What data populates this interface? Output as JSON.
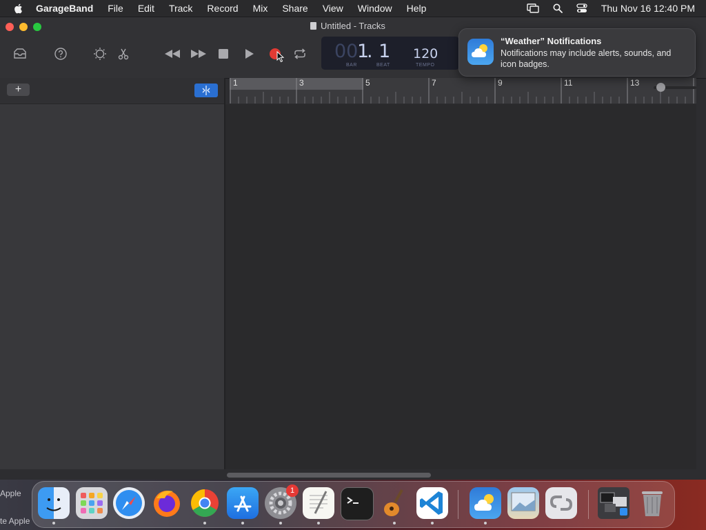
{
  "menubar": {
    "app_name": "GarageBand",
    "items": [
      "File",
      "Edit",
      "Track",
      "Record",
      "Mix",
      "Share",
      "View",
      "Window",
      "Help"
    ],
    "clock": "Thu Nov 16  12:40 PM"
  },
  "window": {
    "title": "Untitled - Tracks"
  },
  "lcd": {
    "bar_dim": "00",
    "bar": "1",
    "beat": ". 1",
    "bar_label": "BAR",
    "beat_label": "BEAT",
    "tempo": "120",
    "tempo_label": "TEMPO"
  },
  "notification": {
    "title": "“Weather” Notifications",
    "body": "Notifications may include alerts, sounds, and icon badges."
  },
  "tracks": {
    "add_label": "+"
  },
  "ruler": {
    "bars": [
      "1",
      "3",
      "5",
      "7",
      "9",
      "11",
      "13"
    ]
  },
  "dock": {
    "apps": [
      "Finder",
      "Launchpad",
      "Safari",
      "Firefox",
      "Chrome",
      "App Store",
      "System Settings",
      "TextEdit",
      "Terminal",
      "GarageBand",
      "Visual Studio Code",
      "Weather",
      "Preview",
      "Keychain",
      "Downloads",
      "Trash"
    ],
    "settings_badge": "1"
  },
  "wallpaper": {
    "text1": "Apple",
    "text2": "te Apple"
  },
  "colors": {
    "record": "#e23a33",
    "accent": "#2a6fd1",
    "close": "#ff5f57",
    "minimize": "#febc2e",
    "zoom": "#28c840"
  }
}
